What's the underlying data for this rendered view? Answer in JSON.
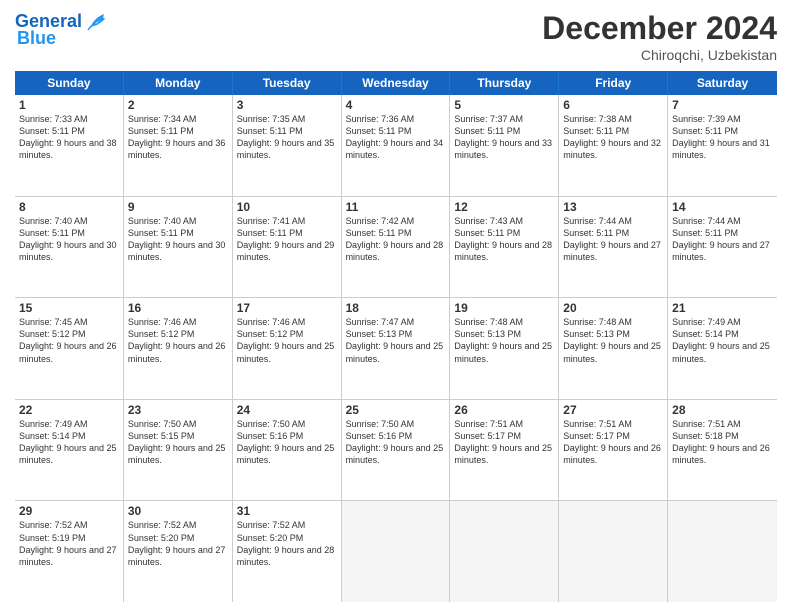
{
  "logo": {
    "text_general": "General",
    "text_blue": "Blue"
  },
  "title": "December 2024",
  "location": "Chiroqchi, Uzbekistan",
  "days_of_week": [
    "Sunday",
    "Monday",
    "Tuesday",
    "Wednesday",
    "Thursday",
    "Friday",
    "Saturday"
  ],
  "weeks": [
    [
      {
        "day": "1",
        "sunrise": "Sunrise: 7:33 AM",
        "sunset": "Sunset: 5:11 PM",
        "daylight": "Daylight: 9 hours and 38 minutes."
      },
      {
        "day": "2",
        "sunrise": "Sunrise: 7:34 AM",
        "sunset": "Sunset: 5:11 PM",
        "daylight": "Daylight: 9 hours and 36 minutes."
      },
      {
        "day": "3",
        "sunrise": "Sunrise: 7:35 AM",
        "sunset": "Sunset: 5:11 PM",
        "daylight": "Daylight: 9 hours and 35 minutes."
      },
      {
        "day": "4",
        "sunrise": "Sunrise: 7:36 AM",
        "sunset": "Sunset: 5:11 PM",
        "daylight": "Daylight: 9 hours and 34 minutes."
      },
      {
        "day": "5",
        "sunrise": "Sunrise: 7:37 AM",
        "sunset": "Sunset: 5:11 PM",
        "daylight": "Daylight: 9 hours and 33 minutes."
      },
      {
        "day": "6",
        "sunrise": "Sunrise: 7:38 AM",
        "sunset": "Sunset: 5:11 PM",
        "daylight": "Daylight: 9 hours and 32 minutes."
      },
      {
        "day": "7",
        "sunrise": "Sunrise: 7:39 AM",
        "sunset": "Sunset: 5:11 PM",
        "daylight": "Daylight: 9 hours and 31 minutes."
      }
    ],
    [
      {
        "day": "8",
        "sunrise": "Sunrise: 7:40 AM",
        "sunset": "Sunset: 5:11 PM",
        "daylight": "Daylight: 9 hours and 30 minutes."
      },
      {
        "day": "9",
        "sunrise": "Sunrise: 7:40 AM",
        "sunset": "Sunset: 5:11 PM",
        "daylight": "Daylight: 9 hours and 30 minutes."
      },
      {
        "day": "10",
        "sunrise": "Sunrise: 7:41 AM",
        "sunset": "Sunset: 5:11 PM",
        "daylight": "Daylight: 9 hours and 29 minutes."
      },
      {
        "day": "11",
        "sunrise": "Sunrise: 7:42 AM",
        "sunset": "Sunset: 5:11 PM",
        "daylight": "Daylight: 9 hours and 28 minutes."
      },
      {
        "day": "12",
        "sunrise": "Sunrise: 7:43 AM",
        "sunset": "Sunset: 5:11 PM",
        "daylight": "Daylight: 9 hours and 28 minutes."
      },
      {
        "day": "13",
        "sunrise": "Sunrise: 7:44 AM",
        "sunset": "Sunset: 5:11 PM",
        "daylight": "Daylight: 9 hours and 27 minutes."
      },
      {
        "day": "14",
        "sunrise": "Sunrise: 7:44 AM",
        "sunset": "Sunset: 5:11 PM",
        "daylight": "Daylight: 9 hours and 27 minutes."
      }
    ],
    [
      {
        "day": "15",
        "sunrise": "Sunrise: 7:45 AM",
        "sunset": "Sunset: 5:12 PM",
        "daylight": "Daylight: 9 hours and 26 minutes."
      },
      {
        "day": "16",
        "sunrise": "Sunrise: 7:46 AM",
        "sunset": "Sunset: 5:12 PM",
        "daylight": "Daylight: 9 hours and 26 minutes."
      },
      {
        "day": "17",
        "sunrise": "Sunrise: 7:46 AM",
        "sunset": "Sunset: 5:12 PM",
        "daylight": "Daylight: 9 hours and 25 minutes."
      },
      {
        "day": "18",
        "sunrise": "Sunrise: 7:47 AM",
        "sunset": "Sunset: 5:13 PM",
        "daylight": "Daylight: 9 hours and 25 minutes."
      },
      {
        "day": "19",
        "sunrise": "Sunrise: 7:48 AM",
        "sunset": "Sunset: 5:13 PM",
        "daylight": "Daylight: 9 hours and 25 minutes."
      },
      {
        "day": "20",
        "sunrise": "Sunrise: 7:48 AM",
        "sunset": "Sunset: 5:13 PM",
        "daylight": "Daylight: 9 hours and 25 minutes."
      },
      {
        "day": "21",
        "sunrise": "Sunrise: 7:49 AM",
        "sunset": "Sunset: 5:14 PM",
        "daylight": "Daylight: 9 hours and 25 minutes."
      }
    ],
    [
      {
        "day": "22",
        "sunrise": "Sunrise: 7:49 AM",
        "sunset": "Sunset: 5:14 PM",
        "daylight": "Daylight: 9 hours and 25 minutes."
      },
      {
        "day": "23",
        "sunrise": "Sunrise: 7:50 AM",
        "sunset": "Sunset: 5:15 PM",
        "daylight": "Daylight: 9 hours and 25 minutes."
      },
      {
        "day": "24",
        "sunrise": "Sunrise: 7:50 AM",
        "sunset": "Sunset: 5:16 PM",
        "daylight": "Daylight: 9 hours and 25 minutes."
      },
      {
        "day": "25",
        "sunrise": "Sunrise: 7:50 AM",
        "sunset": "Sunset: 5:16 PM",
        "daylight": "Daylight: 9 hours and 25 minutes."
      },
      {
        "day": "26",
        "sunrise": "Sunrise: 7:51 AM",
        "sunset": "Sunset: 5:17 PM",
        "daylight": "Daylight: 9 hours and 25 minutes."
      },
      {
        "day": "27",
        "sunrise": "Sunrise: 7:51 AM",
        "sunset": "Sunset: 5:17 PM",
        "daylight": "Daylight: 9 hours and 26 minutes."
      },
      {
        "day": "28",
        "sunrise": "Sunrise: 7:51 AM",
        "sunset": "Sunset: 5:18 PM",
        "daylight": "Daylight: 9 hours and 26 minutes."
      }
    ],
    [
      {
        "day": "29",
        "sunrise": "Sunrise: 7:52 AM",
        "sunset": "Sunset: 5:19 PM",
        "daylight": "Daylight: 9 hours and 27 minutes."
      },
      {
        "day": "30",
        "sunrise": "Sunrise: 7:52 AM",
        "sunset": "Sunset: 5:20 PM",
        "daylight": "Daylight: 9 hours and 27 minutes."
      },
      {
        "day": "31",
        "sunrise": "Sunrise: 7:52 AM",
        "sunset": "Sunset: 5:20 PM",
        "daylight": "Daylight: 9 hours and 28 minutes."
      },
      null,
      null,
      null,
      null
    ]
  ]
}
